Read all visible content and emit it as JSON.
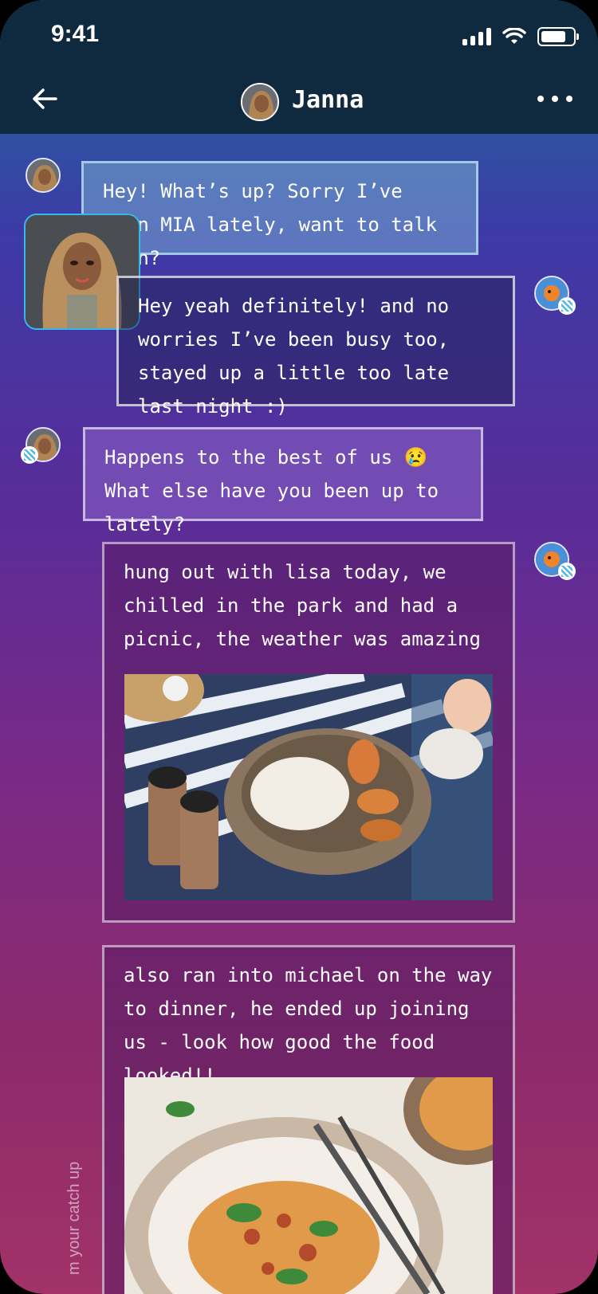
{
  "status_bar": {
    "time": "9:41"
  },
  "header": {
    "contact_name": "Janna"
  },
  "messages": [
    {
      "id": "m1",
      "sender": "Janna",
      "text": "Hey! What’s up? Sorry I’ve been MIA lately, want to talk soon?"
    },
    {
      "id": "m2",
      "sender": "me",
      "text": "Hey yeah definitely! and no worries I’ve been busy too,  stayed up a little too late last night :)"
    },
    {
      "id": "m3",
      "sender": "Janna",
      "text": "Happens to the best of us 😢 What else have you been up to lately?"
    },
    {
      "id": "m4",
      "sender": "me",
      "text": "hung out with lisa today, we chilled in the park and had a picnic, the weather was amazing",
      "image": "picnic-photo"
    },
    {
      "id": "m5",
      "sender": "me",
      "text": "also ran into michael on the way to dinner, he ended up joining us - look how good the food looked!!",
      "image": "pasta-photo"
    }
  ],
  "side_hint": "m your catch up",
  "icons": {
    "back": "arrow-left-icon",
    "more": "more-horizontal-icon",
    "badge": "sticker-badge-icon"
  },
  "colors": {
    "header_bg": "#0f2a3f",
    "accent": "#34b9e9"
  }
}
